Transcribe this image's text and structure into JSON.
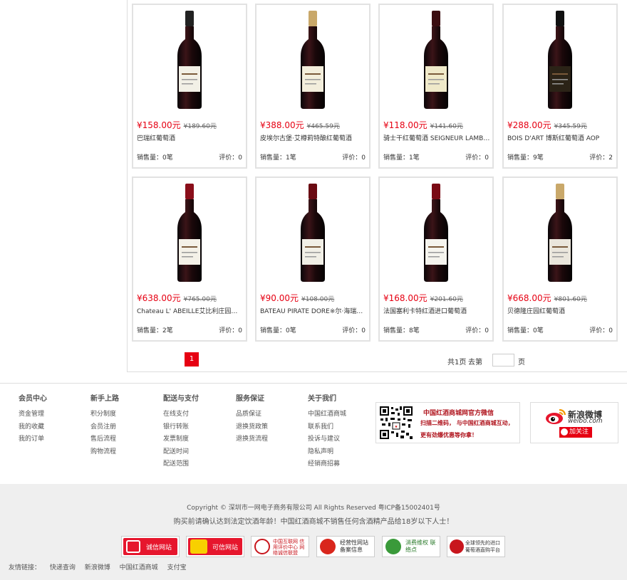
{
  "products": [
    {
      "price": "¥158.00元",
      "old_price": "¥189.60元",
      "name": "巴瑞红葡萄酒",
      "sales": "销售量：0笔",
      "rating": "评价：0",
      "label_color": "#f2f0e6",
      "cap_color": "#222"
    },
    {
      "price": "¥388.00元",
      "old_price": "¥465.59元",
      "name": "皮埃尔古堡·艾樽莉特酿红葡萄酒",
      "sales": "销售量：1笔",
      "rating": "评价：0",
      "label_color": "#f3eedc",
      "cap_color": "#c9a86a"
    },
    {
      "price": "¥118.00元",
      "old_price": "¥141.60元",
      "name": "骑士干红葡萄酒 SEIGNEUR LAMBERT",
      "sales": "销售量：1笔",
      "rating": "评价：0",
      "label_color": "#efe9c9",
      "cap_color": "#3a0d10"
    },
    {
      "price": "¥288.00元",
      "old_price": "¥345.59元",
      "name": "BOIS D'ART 博斯红葡萄酒 AOP",
      "sales": "销售量：9笔",
      "rating": "评价：2",
      "label_color": "#2b2317",
      "cap_color": "#111"
    },
    {
      "price": "¥638.00元",
      "old_price": "¥765.00元",
      "name": "Chateau L' ABEILLE艾比利庄园红葡萄酒",
      "sales": "销售量：2笔",
      "rating": "评价：0",
      "label_color": "#f4f1e8",
      "cap_color": "#8a0e1a"
    },
    {
      "price": "¥90.00元",
      "old_price": "¥108.00元",
      "name": "BATEAU PIRATE DORE※尔·海瑞船法国红葡萄酒",
      "sales": "销售量：0笔",
      "rating": "评价：0",
      "label_color": "#f1efe6",
      "cap_color": "#6a0a12"
    },
    {
      "price": "¥168.00元",
      "old_price": "¥201.60元",
      "name": "法国塞利卡特红酒进口葡萄酒",
      "sales": "销售量：8笔",
      "rating": "评价：0",
      "label_color": "#f5f4ee",
      "cap_color": "#7a0a14"
    },
    {
      "price": "¥668.00元",
      "old_price": "¥801.60元",
      "name": "贝德隆庄园红葡萄酒",
      "sales": "销售量：0笔",
      "rating": "评价：0",
      "label_color": "#eae6dc",
      "cap_color": "#c9a86a"
    }
  ],
  "pagination": {
    "current": "1",
    "info": "共1页",
    "goto": "去第",
    "unit": "页"
  },
  "footer": {
    "columns": [
      {
        "title": "会员中心",
        "links": [
          "资金管理",
          "我的收藏",
          "我的订单"
        ]
      },
      {
        "title": "新手上路",
        "links": [
          "积分制度",
          "会员注册",
          "售后流程",
          "购物流程"
        ]
      },
      {
        "title": "配送与支付",
        "links": [
          "在线支付",
          "银行转账",
          "发票制度",
          "配送时间",
          "配送范围"
        ]
      },
      {
        "title": "服务保证",
        "links": [
          "品质保证",
          "退换货政策",
          "退换货流程"
        ]
      },
      {
        "title": "关于我们",
        "links": [
          "中国红酒商城",
          "联系我们",
          "投诉与建议",
          "隐私声明",
          "经销商招募"
        ]
      }
    ],
    "weixin": {
      "title": "中国红酒商城网官方微信",
      "line1": "扫描二维码， 与中国红酒商城互动，",
      "line2": "更有劲爆优惠等你拿！"
    },
    "weibo": {
      "name": "新浪微博",
      "url": "weibo.com",
      "follow": "加关注"
    },
    "copyright": "Copyright © 深圳市一网电子商务有限公司 All Rights Reserved 粤ICP备15002401号",
    "notice": "购买前请确认达到法定饮酒年龄！中国红酒商城不销售任何含酒精产品给18岁以下人士！",
    "badges": [
      {
        "label": "诚信网站"
      },
      {
        "label": "可信网站"
      },
      {
        "label": "中国互联网 信用评价中心 网络诚信联盟"
      },
      {
        "label": "经营性网站 备案信息"
      },
      {
        "label": "消费维权 联络点"
      },
      {
        "label": "全球领先的进口 葡萄酒直购平台"
      }
    ],
    "friend_links_label": "友情链接：",
    "friend_links": [
      "快递查询",
      "新浪微博",
      "中国红酒商城",
      "支付宝"
    ]
  }
}
